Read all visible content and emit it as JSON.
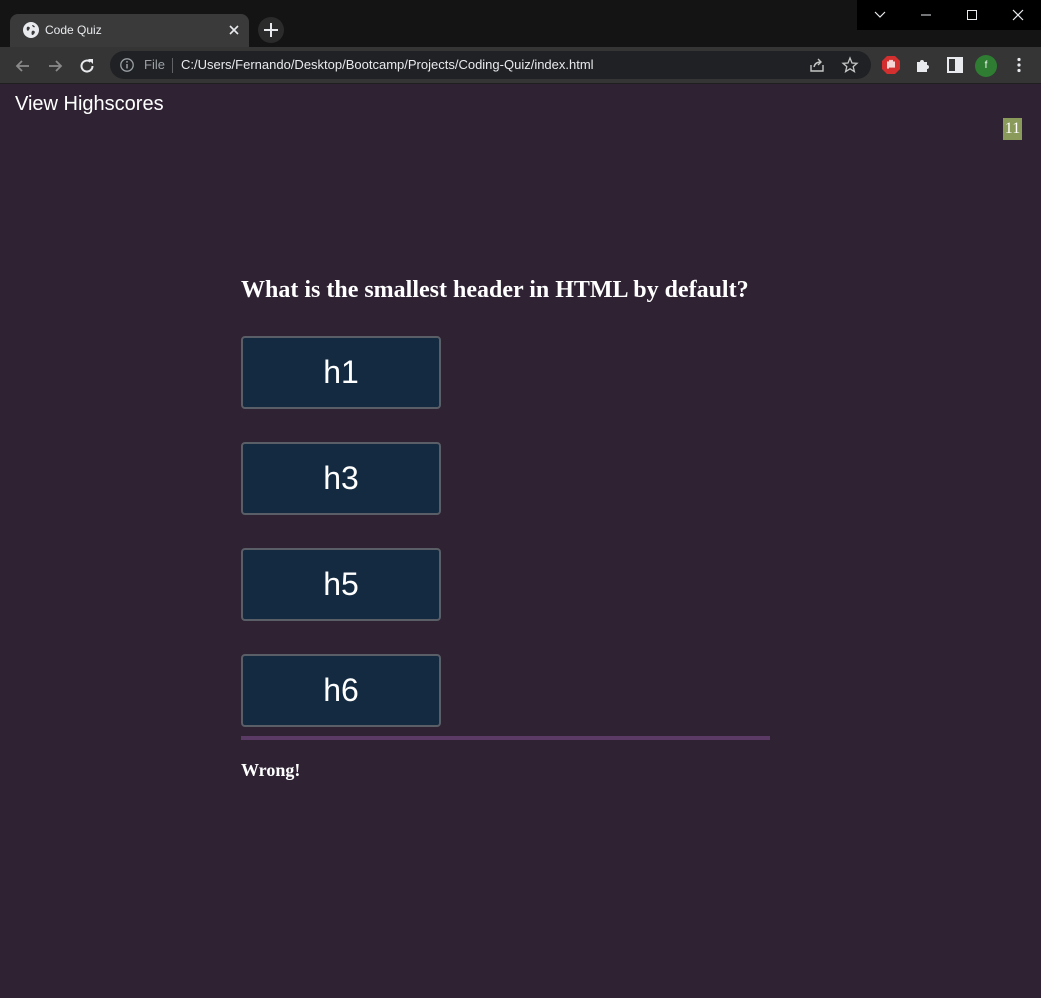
{
  "browser": {
    "tab_title": "Code Quiz",
    "file_label": "File",
    "url": "C:/Users/Fernando/Desktop/Bootcamp/Projects/Coding-Quiz/index.html",
    "profile_initial": "f"
  },
  "page": {
    "view_highscores": "View Highscores",
    "timer": "11",
    "question": "What is the smallest header in HTML by default?",
    "choices": [
      "h1",
      "h3",
      "h5",
      "h6"
    ],
    "feedback": "Wrong!"
  },
  "colors": {
    "background": "#2e2233",
    "button_bg": "#142a40",
    "divider": "#5c3a66",
    "timer_bg": "#8a9a5b"
  }
}
